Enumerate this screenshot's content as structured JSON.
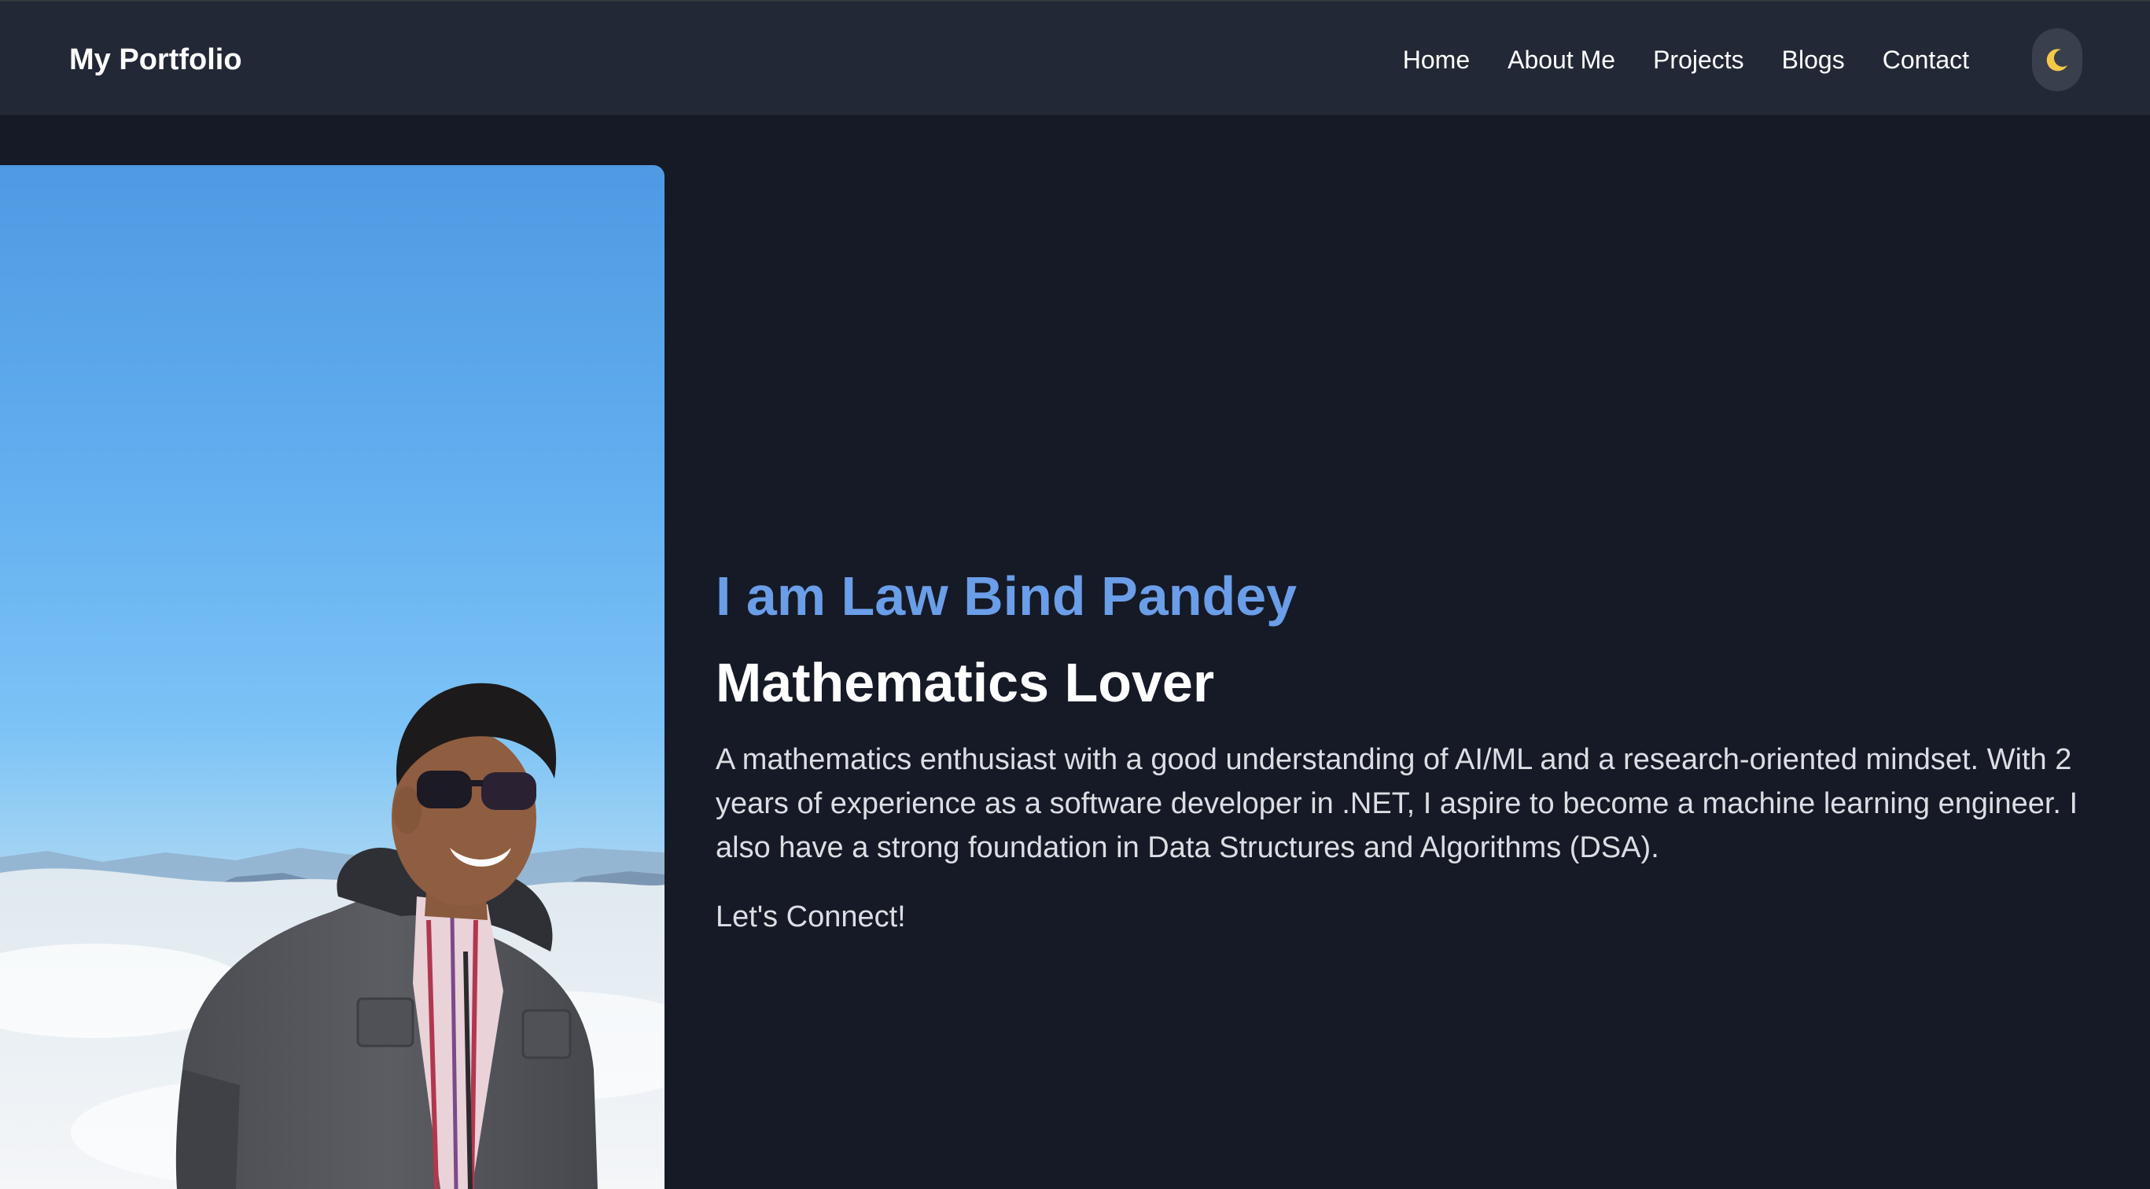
{
  "navbar": {
    "brand": "My Portfolio",
    "links": [
      {
        "label": "Home"
      },
      {
        "label": "About Me"
      },
      {
        "label": "Projects"
      },
      {
        "label": "Blogs"
      },
      {
        "label": "Contact"
      }
    ],
    "theme_toggle_icon": "moon-icon"
  },
  "hero": {
    "name": "I am Law Bind Pandey",
    "role": "Mathematics Lover",
    "description": "A mathematics enthusiast with a good understanding of AI/ML and a research-oriented mindset. With 2 years of experience as a software developer in .NET, I aspire to become a machine learning engineer. I also have a strong foundation in Data Structures and Algorithms (DSA).",
    "cta": "Let's Connect!"
  },
  "colors": {
    "page_background": "#151a26",
    "navbar_background": "#232836",
    "accent": "#6b9ee8",
    "text": "#ffffff",
    "muted_text": "#dcdee3"
  }
}
